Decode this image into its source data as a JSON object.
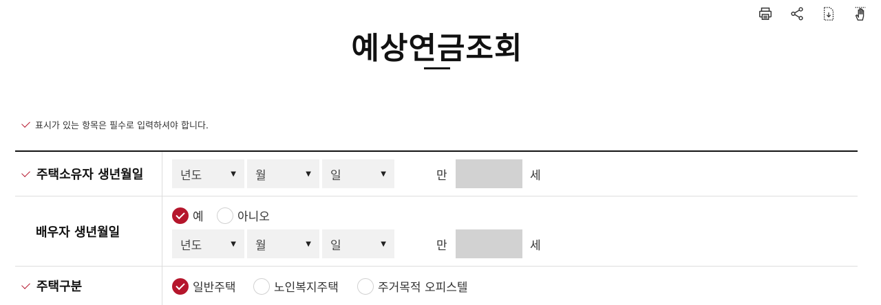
{
  "toolbar": {
    "icons": [
      "print-icon",
      "share-icon",
      "document-download-icon",
      "hand-drag-icon"
    ]
  },
  "page_title": "예상연금조회",
  "notice": "표시가 있는 항목은 필수로 입력하셔야 합니다.",
  "colors": {
    "accent": "#b5162c",
    "age_box": "#d2d2d2",
    "select_bg": "#f1f1f1"
  },
  "owner_birth": {
    "label": "주택소유자 생년월일",
    "year": "년도",
    "month": "월",
    "day": "일",
    "age_prefix": "만",
    "age_suffix": "세"
  },
  "spouse_birth": {
    "label": "배우자 생년월일",
    "options": [
      {
        "label": "예",
        "checked": true
      },
      {
        "label": "아니오",
        "checked": false
      }
    ],
    "year": "년도",
    "month": "월",
    "day": "일",
    "age_prefix": "만",
    "age_suffix": "세"
  },
  "house_type": {
    "label": "주택구분",
    "options": [
      {
        "label": "일반주택",
        "checked": true
      },
      {
        "label": "노인복지주택",
        "checked": false
      },
      {
        "label": "주거목적 오피스텔",
        "checked": false
      }
    ]
  }
}
